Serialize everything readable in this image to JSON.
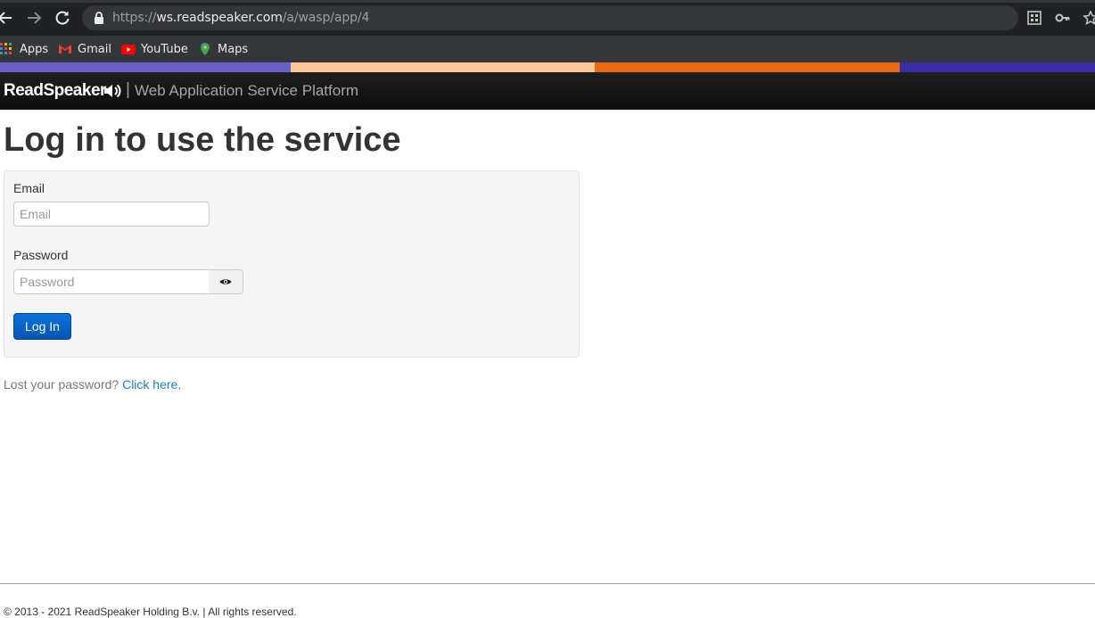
{
  "browser": {
    "url_scheme": "https://",
    "url_host": "ws.readspeaker.com",
    "url_path": "/a/wasp/app/4",
    "bookmarks": [
      {
        "label": "Apps",
        "icon": "apps-grid-icon"
      },
      {
        "label": "Gmail",
        "icon": "gmail-icon"
      },
      {
        "label": "YouTube",
        "icon": "youtube-icon"
      },
      {
        "label": "Maps",
        "icon": "maps-icon"
      }
    ]
  },
  "stripe_colors": [
    "#6a62c9",
    "#f9c896",
    "#e8690f",
    "#3a2fa6"
  ],
  "header": {
    "brand": "ReadSpeaker",
    "separator": "|",
    "subtitle": "Web Application Service Platform"
  },
  "main": {
    "title": "Log in to use the service",
    "email_label": "Email",
    "email_placeholder": "Email",
    "password_label": "Password",
    "password_placeholder": "Password",
    "login_button": "Log In",
    "lost_password_text": "Lost your password? ",
    "lost_password_link": "Click here",
    "lost_password_period": "."
  },
  "footer": {
    "copyright": "© 2013 - 2021 ReadSpeaker Holding B.v. | All rights reserved."
  },
  "colors": {
    "primary_button": "#0a6bd0",
    "link": "#1a7fb5",
    "header_bg": "#151515"
  }
}
